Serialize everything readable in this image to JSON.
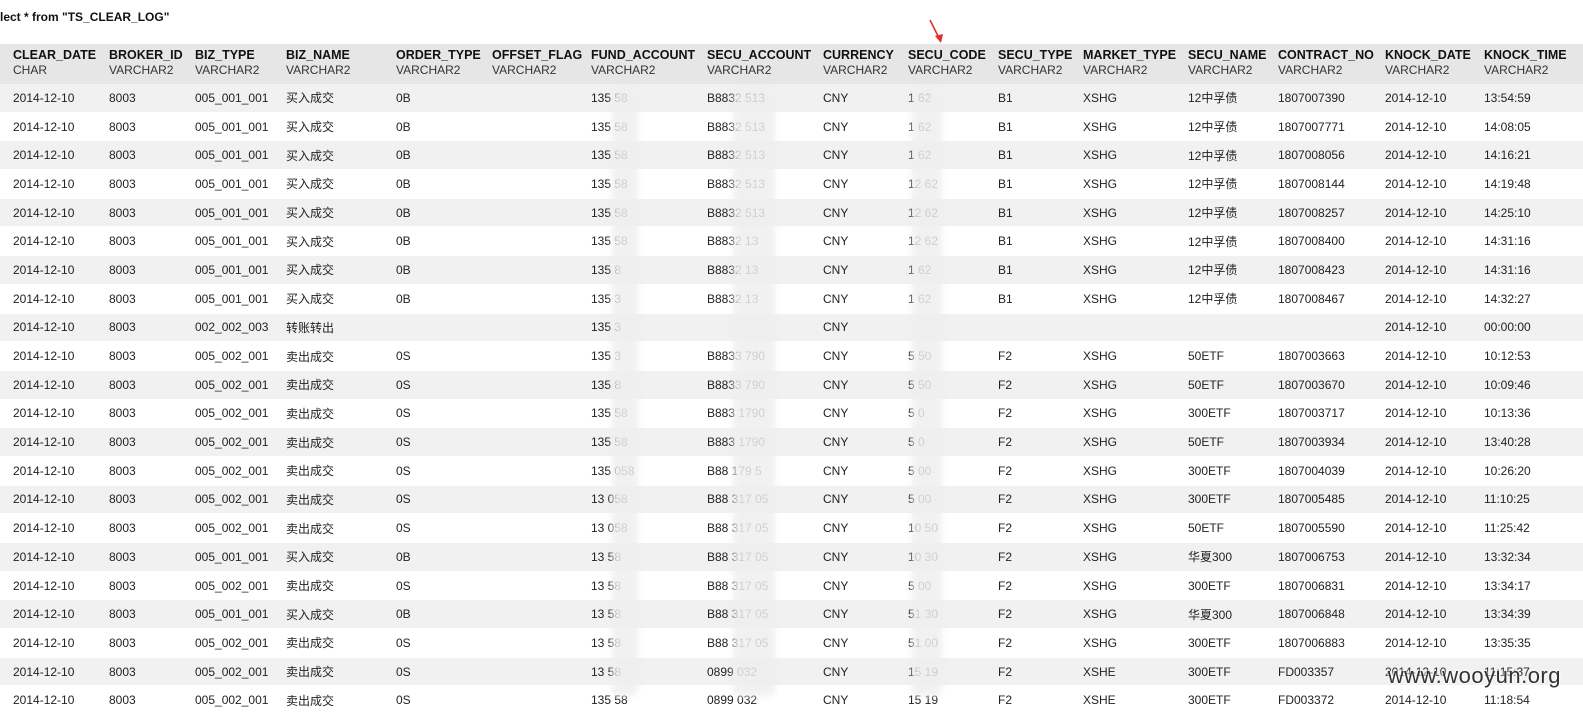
{
  "query": "lect * from \"TS_CLEAR_LOG\"",
  "columns": [
    {
      "name": "CLEAR_DATE",
      "type": "CHAR"
    },
    {
      "name": "BROKER_ID",
      "type": "VARCHAR2"
    },
    {
      "name": "BIZ_TYPE",
      "type": "VARCHAR2"
    },
    {
      "name": "BIZ_NAME",
      "type": "VARCHAR2"
    },
    {
      "name": "ORDER_TYPE",
      "type": "VARCHAR2"
    },
    {
      "name": "OFFSET_FLAG",
      "type": "VARCHAR2"
    },
    {
      "name": "FUND_ACCOUNT",
      "type": "VARCHAR2"
    },
    {
      "name": "SECU_ACCOUNT",
      "type": "VARCHAR2"
    },
    {
      "name": "CURRENCY",
      "type": "VARCHAR2"
    },
    {
      "name": "SECU_CODE",
      "type": "VARCHAR2"
    },
    {
      "name": "SECU_TYPE",
      "type": "VARCHAR2"
    },
    {
      "name": "MARKET_TYPE",
      "type": "VARCHAR2"
    },
    {
      "name": "SECU_NAME",
      "type": "VARCHAR2"
    },
    {
      "name": "CONTRACT_NO",
      "type": "VARCHAR2"
    },
    {
      "name": "KNOCK_DATE",
      "type": "VARCHAR2"
    },
    {
      "name": "KNOCK_TIME",
      "type": "VARCHAR2"
    }
  ],
  "rows": [
    [
      "2014-12-10",
      "8003",
      "005_001_001",
      "买入成交",
      "0B",
      "",
      "135  58",
      "B8832  513",
      "CNY",
      "1  62",
      "B1",
      "XSHG",
      "12中孚债",
      "1807007390",
      "2014-12-10",
      "13:54:59"
    ],
    [
      "2014-12-10",
      "8003",
      "005_001_001",
      "买入成交",
      "0B",
      "",
      "135  58",
      "B8832  513",
      "CNY",
      "1  62",
      "B1",
      "XSHG",
      "12中孚债",
      "1807007771",
      "2014-12-10",
      "14:08:05"
    ],
    [
      "2014-12-10",
      "8003",
      "005_001_001",
      "买入成交",
      "0B",
      "",
      "135  58",
      "B8832  513",
      "CNY",
      "1  62",
      "B1",
      "XSHG",
      "12中孚债",
      "1807008056",
      "2014-12-10",
      "14:16:21"
    ],
    [
      "2014-12-10",
      "8003",
      "005_001_001",
      "买入成交",
      "0B",
      "",
      "135  58",
      "B8832  513",
      "CNY",
      "12  62",
      "B1",
      "XSHG",
      "12中孚债",
      "1807008144",
      "2014-12-10",
      "14:19:48"
    ],
    [
      "2014-12-10",
      "8003",
      "005_001_001",
      "买入成交",
      "0B",
      "",
      "135  58",
      "B8832  513",
      "CNY",
      "12  62",
      "B1",
      "XSHG",
      "12中孚债",
      "1807008257",
      "2014-12-10",
      "14:25:10"
    ],
    [
      "2014-12-10",
      "8003",
      "005_001_001",
      "买入成交",
      "0B",
      "",
      "135  58",
      "B8832  13",
      "CNY",
      "12  62",
      "B1",
      "XSHG",
      "12中孚债",
      "1807008400",
      "2014-12-10",
      "14:31:16"
    ],
    [
      "2014-12-10",
      "8003",
      "005_001_001",
      "买入成交",
      "0B",
      "",
      "135  8",
      "B8832  13",
      "CNY",
      "1  62",
      "B1",
      "XSHG",
      "12中孚债",
      "1807008423",
      "2014-12-10",
      "14:31:16"
    ],
    [
      "2014-12-10",
      "8003",
      "005_001_001",
      "买入成交",
      "0B",
      "",
      "135  3",
      "B8832  13",
      "CNY",
      "1  62",
      "B1",
      "XSHG",
      "12中孚债",
      "1807008467",
      "2014-12-10",
      "14:32:27"
    ],
    [
      "2014-12-10",
      "8003",
      "002_002_003",
      "转账转出",
      "",
      "",
      "135  3",
      "",
      "CNY",
      "",
      "",
      "",
      "",
      "",
      "2014-12-10",
      "00:00:00"
    ],
    [
      "2014-12-10",
      "8003",
      "005_002_001",
      "卖出成交",
      "0S",
      "",
      "135  3",
      "B8833  790",
      "CNY",
      "5  50",
      "F2",
      "XSHG",
      "50ETF",
      "1807003663",
      "2014-12-10",
      "10:12:53"
    ],
    [
      "2014-12-10",
      "8003",
      "005_002_001",
      "卖出成交",
      "0S",
      "",
      "135  8",
      "B8833  790",
      "CNY",
      "5  50",
      "F2",
      "XSHG",
      "50ETF",
      "1807003670",
      "2014-12-10",
      "10:09:46"
    ],
    [
      "2014-12-10",
      "8003",
      "005_002_001",
      "卖出成交",
      "0S",
      "",
      "135  58",
      "B883  1790",
      "CNY",
      "5  0",
      "F2",
      "XSHG",
      "300ETF",
      "1807003717",
      "2014-12-10",
      "10:13:36"
    ],
    [
      "2014-12-10",
      "8003",
      "005_002_001",
      "卖出成交",
      "0S",
      "",
      "135  58",
      "B883  1790",
      "CNY",
      "5  0",
      "F2",
      "XSHG",
      "50ETF",
      "1807003934",
      "2014-12-10",
      "13:40:28"
    ],
    [
      "2014-12-10",
      "8003",
      "005_002_001",
      "卖出成交",
      "0S",
      "",
      "135  058",
      "B88  179  5",
      "CNY",
      "5  00",
      "F2",
      "XSHG",
      "300ETF",
      "1807004039",
      "2014-12-10",
      "10:26:20"
    ],
    [
      "2014-12-10",
      "8003",
      "005_002_001",
      "卖出成交",
      "0S",
      "",
      "13  058",
      "B88  317  05",
      "CNY",
      "5  00",
      "F2",
      "XSHG",
      "300ETF",
      "1807005485",
      "2014-12-10",
      "11:10:25"
    ],
    [
      "2014-12-10",
      "8003",
      "005_002_001",
      "卖出成交",
      "0S",
      "",
      "13  058",
      "B88  317  05",
      "CNY",
      "  10  50",
      "F2",
      "XSHG",
      "50ETF",
      "1807005590",
      "2014-12-10",
      "11:25:42"
    ],
    [
      "2014-12-10",
      "8003",
      "005_001_001",
      "买入成交",
      "0B",
      "",
      "13  58",
      "B88  317  05",
      "CNY",
      "  10  30",
      "F2",
      "XSHG",
      "华夏300",
      "1807006753",
      "2014-12-10",
      "13:32:34"
    ],
    [
      "2014-12-10",
      "8003",
      "005_002_001",
      "卖出成交",
      "0S",
      "",
      "13  58",
      "B88  317  05",
      "CNY",
      "5  00",
      "F2",
      "XSHG",
      "300ETF",
      "1807006831",
      "2014-12-10",
      "13:34:17"
    ],
    [
      "2014-12-10",
      "8003",
      "005_001_001",
      "买入成交",
      "0B",
      "",
      "13  58",
      "B88  317  05",
      "CNY",
      "51  30",
      "F2",
      "XSHG",
      "华夏300",
      "1807006848",
      "2014-12-10",
      "13:34:39"
    ],
    [
      "2014-12-10",
      "8003",
      "005_002_001",
      "卖出成交",
      "0S",
      "",
      "13  58",
      "B88  317  05",
      "CNY",
      "51  00",
      "F2",
      "XSHG",
      "300ETF",
      "1807006883",
      "2014-12-10",
      "13:35:35"
    ],
    [
      "2014-12-10",
      "8003",
      "005_002_001",
      "卖出成交",
      "0S",
      "",
      "13  58",
      "0899  032",
      "CNY",
      "15  19",
      "F2",
      "XSHE",
      "300ETF",
      "FD003357",
      "2014-12-10",
      "11:15:37"
    ],
    [
      "2014-12-10",
      "8003",
      "005_002_001",
      "卖出成交",
      "0S",
      "",
      "135  58",
      "0899  032",
      "CNY",
      "15  19",
      "F2",
      "XSHE",
      "300ETF",
      "FD003372",
      "2014-12-10",
      "11:18:54"
    ]
  ],
  "watermark": "www.wooyun.org",
  "colors": {
    "header_bg": "#e6e6e6",
    "row_alt_bg": "#f1f1f1",
    "arrow": "#e0302a"
  }
}
